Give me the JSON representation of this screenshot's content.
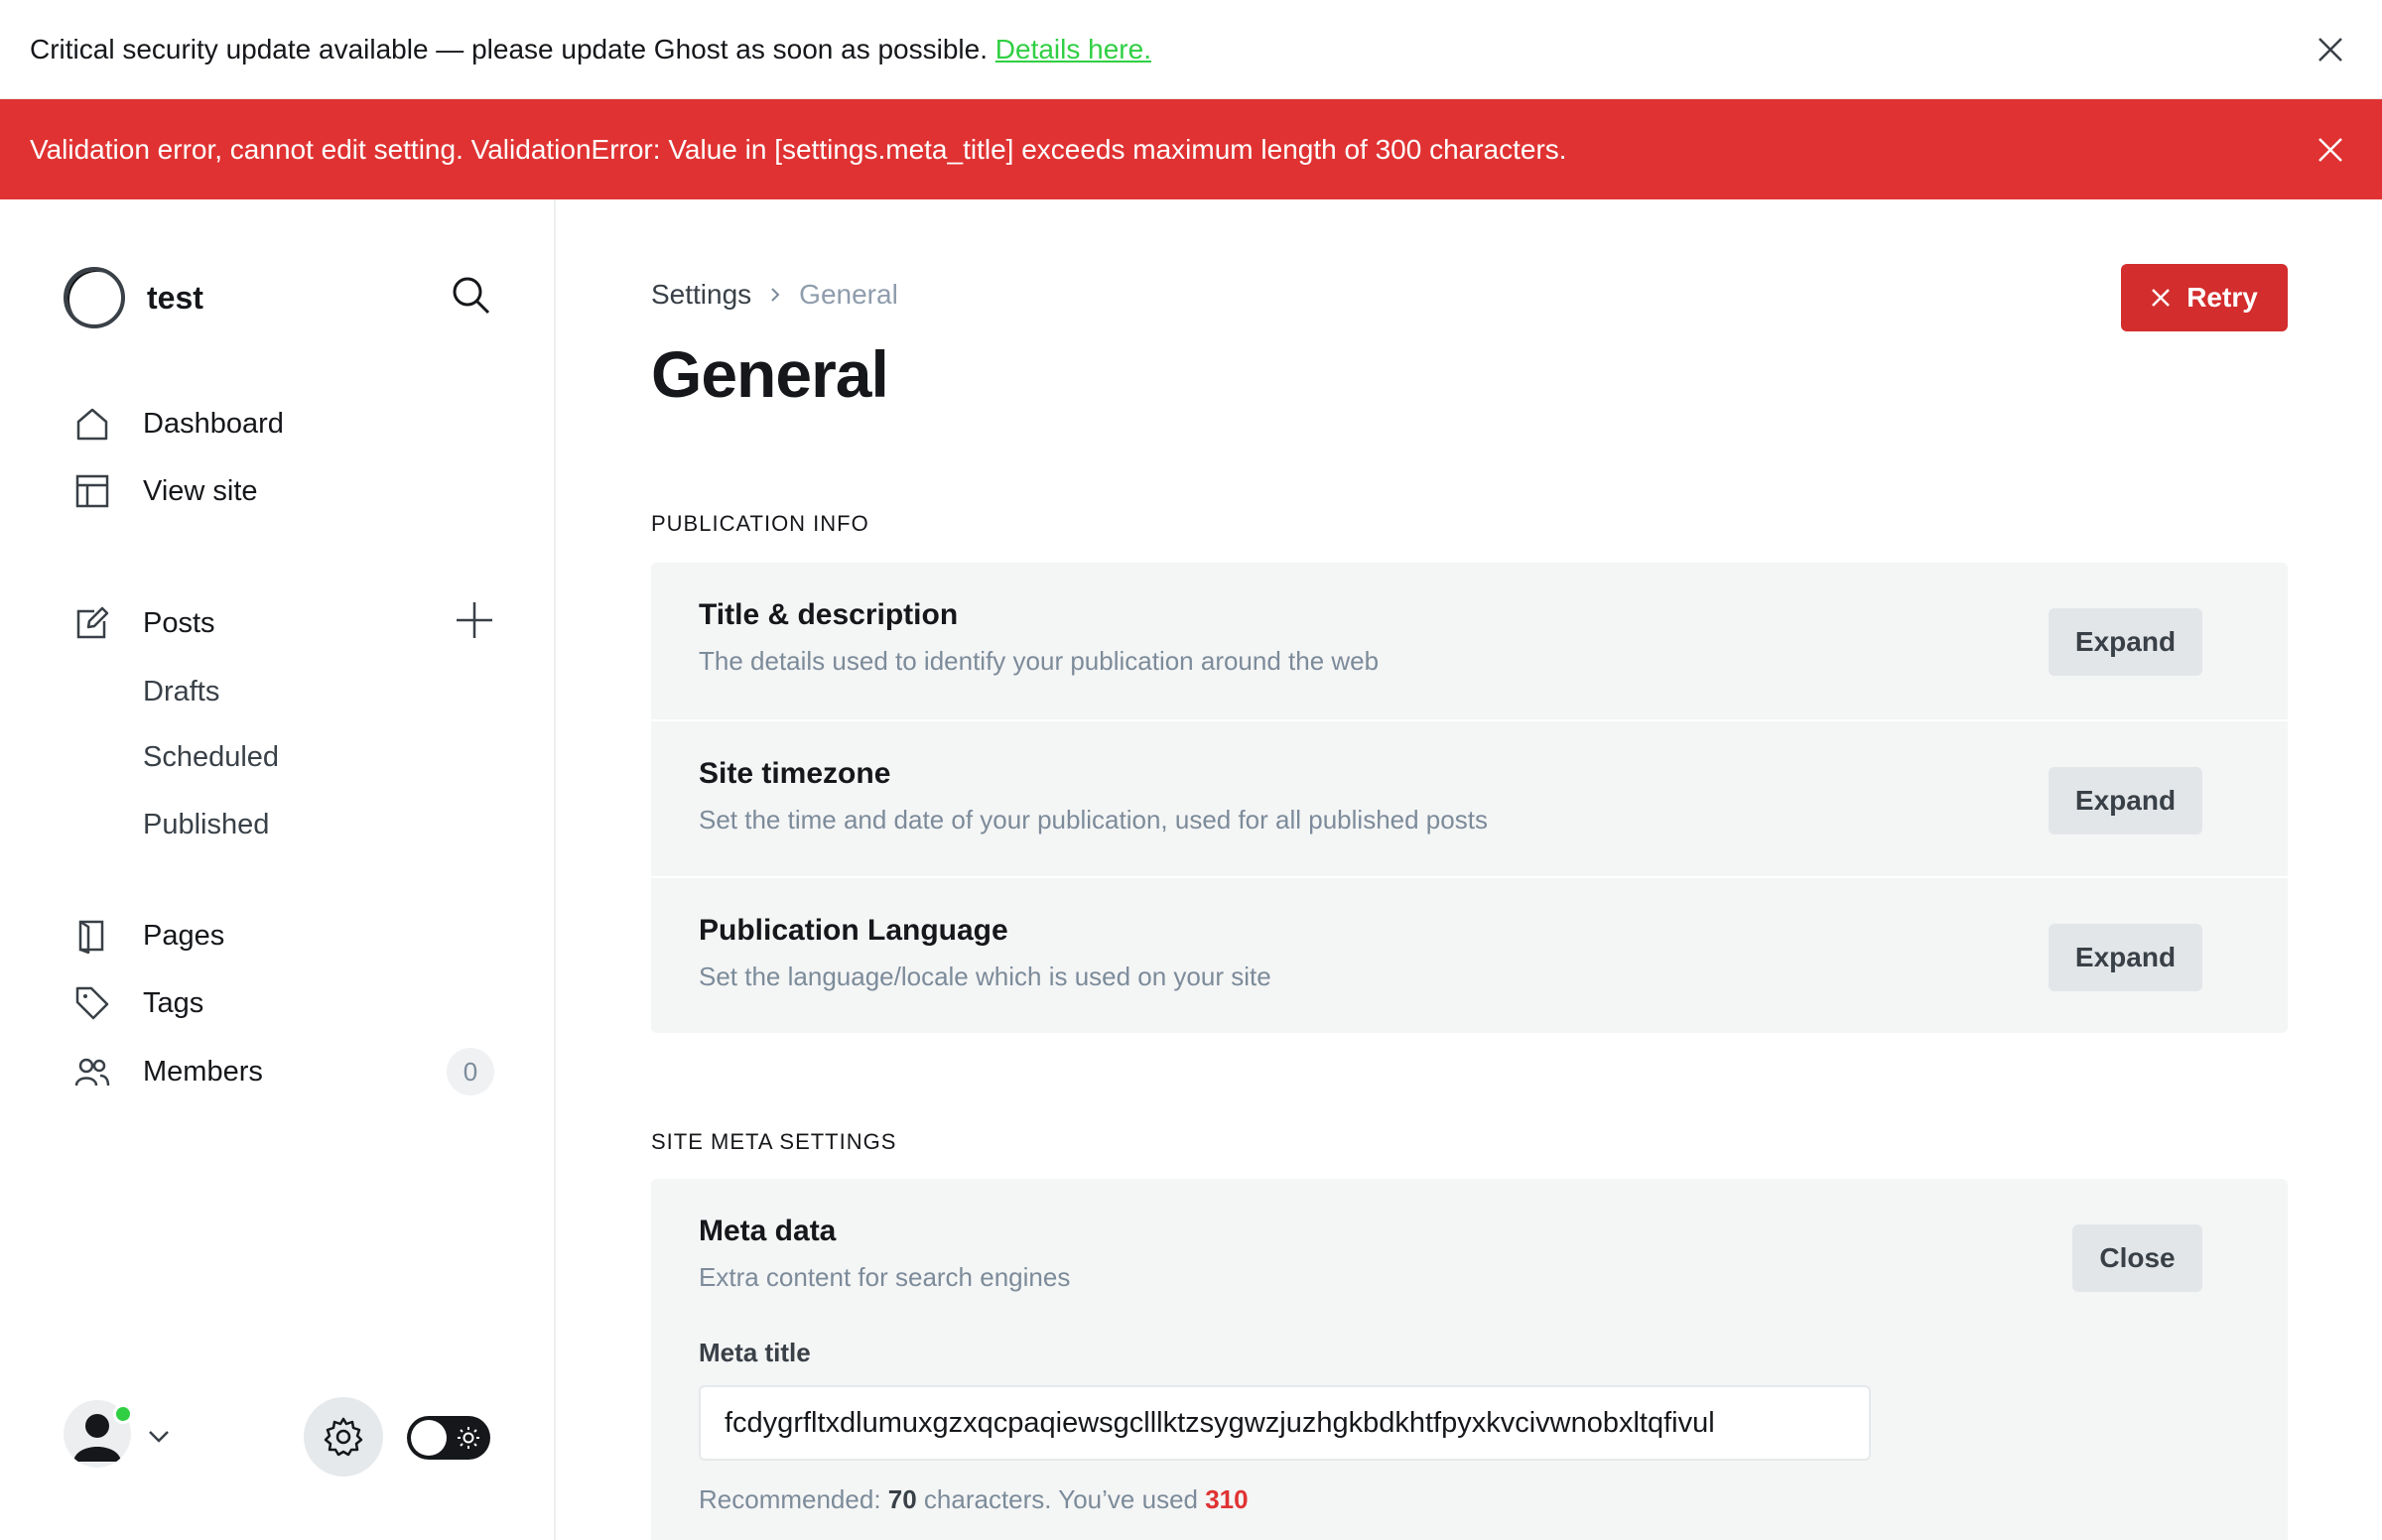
{
  "banners": {
    "update": {
      "message": "Critical security update available — please update Ghost as soon as possible.",
      "link": "Details here."
    },
    "error": {
      "message": "Validation error, cannot edit setting. ValidationError: Value in [settings.meta_title] exceeds maximum length of 300 characters."
    }
  },
  "sidebar": {
    "site_name": "test",
    "nav": {
      "dashboard": "Dashboard",
      "view_site": "View site",
      "posts": "Posts",
      "drafts": "Drafts",
      "scheduled": "Scheduled",
      "published": "Published",
      "pages": "Pages",
      "tags": "Tags",
      "members": "Members",
      "members_count": "0"
    }
  },
  "main": {
    "breadcrumb": {
      "root": "Settings",
      "current": "General"
    },
    "title": "General",
    "retry_label": "Retry",
    "publication_info": {
      "heading": "PUBLICATION INFO",
      "rows": [
        {
          "title": "Title & description",
          "desc": "The details used to identify your publication around the web",
          "button": "Expand"
        },
        {
          "title": "Site timezone",
          "desc": "Set the time and date of your publication, used for all published posts",
          "button": "Expand"
        },
        {
          "title": "Publication Language",
          "desc": "Set the language/locale which is used on your site",
          "button": "Expand"
        }
      ]
    },
    "site_meta": {
      "heading": "SITE META SETTINGS",
      "title": "Meta data",
      "desc": "Extra content for search engines",
      "button": "Close",
      "field_label": "Meta title",
      "field_value": "fcdygrfltxdlumuxgzxqcpaqiewsgclllktzsygwzjuzhgkbdkhtfpyxkvcivwnobxltqfivul",
      "hint_prefix": "Recommended: ",
      "hint_recommended": "70",
      "hint_middle": " characters. You’ve used ",
      "hint_used": "310"
    }
  },
  "colors": {
    "error_banner": "#e03232",
    "retry_button": "#d32d2d",
    "link_green": "#30cf43",
    "status_online": "#30cf43"
  }
}
